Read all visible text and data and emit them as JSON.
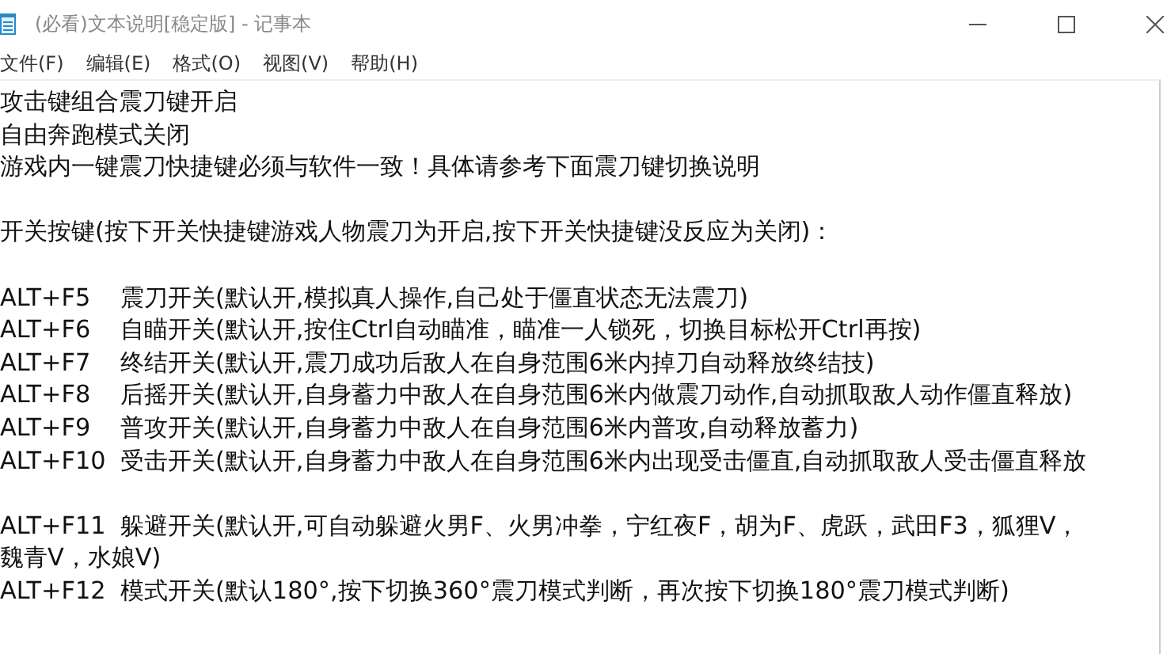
{
  "window": {
    "title": "(必看)文本说明[稳定版] - 记事本"
  },
  "menu": [
    "文件(F)",
    "编辑(E)",
    "格式(O)",
    "视图(V)",
    "帮助(H)"
  ],
  "paragraphs": [
    [
      {
        "text": "攻击键组合震刀键开启"
      },
      {
        "text": "自由奔跑模式关闭"
      },
      {
        "text": "游戏内一键震刀快捷键必须与软件一致！具体请参考下面震刀键切换说明"
      }
    ],
    [
      {
        "text": "开关按键(按下开关快捷键游戏人物震刀为开启,按下开关快捷键没反应为关闭)："
      }
    ],
    [
      {
        "key": "ALT+F5",
        "text": "震刀开关(默认开,模拟真人操作,自己处于僵直状态无法震刀)"
      },
      {
        "key": "ALT+F6",
        "text": "自瞄开关(默认开,按住Ctrl自动瞄准，瞄准一人锁死，切换目标松开Ctrl再按)"
      },
      {
        "key": "ALT+F7",
        "text": "终结开关(默认开,震刀成功后敌人在自身范围6米内掉刀自动释放终结技)"
      },
      {
        "key": "ALT+F8",
        "text": "后摇开关(默认开,自身蓄力中敌人在自身范围6米内做震刀动作,自动抓取敌人动作僵直释放)"
      },
      {
        "key": "ALT+F9",
        "text": "普攻开关(默认开,自身蓄力中敌人在自身范围6米内普攻,自动释放蓄力)"
      },
      {
        "key": "ALT+F10",
        "text": "受击开关(默认开,自身蓄力中敌人在自身范围6米内出现受击僵直,自动抓取敌人受击僵直释放"
      }
    ],
    [
      {
        "key": "ALT+F11",
        "text": "躲避开关(默认开,可自动躲避火男F、火男冲拳，宁红夜F，胡为F、虎跃，武田F3，狐狸V，"
      },
      {
        "text": "魏青V，水娘V)"
      },
      {
        "key": "ALT+F12",
        "text": "模式开关(默认180°,按下切换360°震刀模式判断，再次按下切换180°震刀模式判断)"
      }
    ]
  ]
}
